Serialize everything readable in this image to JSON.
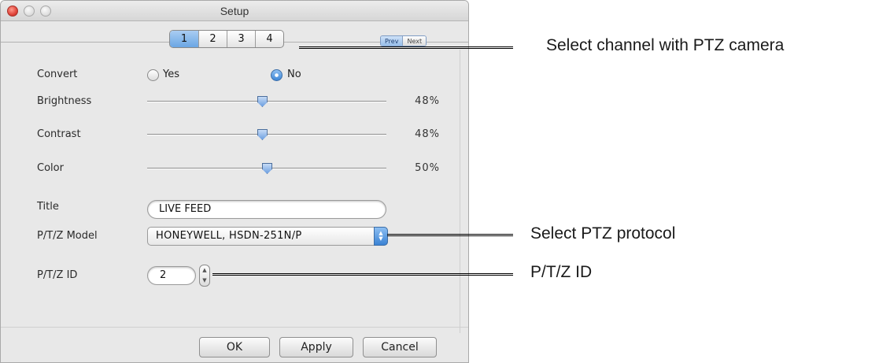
{
  "window": {
    "title": "Setup",
    "tabs": [
      {
        "label": "1",
        "active": true
      },
      {
        "label": "2",
        "active": false
      },
      {
        "label": "3",
        "active": false
      },
      {
        "label": "4",
        "active": false
      }
    ],
    "prev_label": "Prev",
    "next_label": "Next"
  },
  "form": {
    "convert": {
      "label": "Convert",
      "options": [
        {
          "label": "Yes",
          "selected": false
        },
        {
          "label": "No",
          "selected": true
        }
      ]
    },
    "brightness": {
      "label": "Brightness",
      "value_text": "48%",
      "value": 48
    },
    "contrast": {
      "label": "Contrast",
      "value_text": "48%",
      "value": 48
    },
    "color": {
      "label": "Color",
      "value_text": "50%",
      "value": 50
    },
    "title": {
      "label": "Title",
      "value": "LIVE FEED"
    },
    "ptz_model": {
      "label": "P/T/Z Model",
      "value": "HONEYWELL, HSDN-251N/P"
    },
    "ptz_id": {
      "label": "P/T/Z ID",
      "value": "2"
    }
  },
  "buttons": {
    "ok": "OK",
    "apply": "Apply",
    "cancel": "Cancel"
  },
  "callouts": {
    "channel": "Select channel with PTZ camera",
    "protocol": "Select PTZ protocol",
    "ptz_id": "P/T/Z ID"
  },
  "colors": {
    "accent_blue": "#3a82d4",
    "close_red": "#e0443a",
    "window_bg": "#e8e8e8"
  }
}
